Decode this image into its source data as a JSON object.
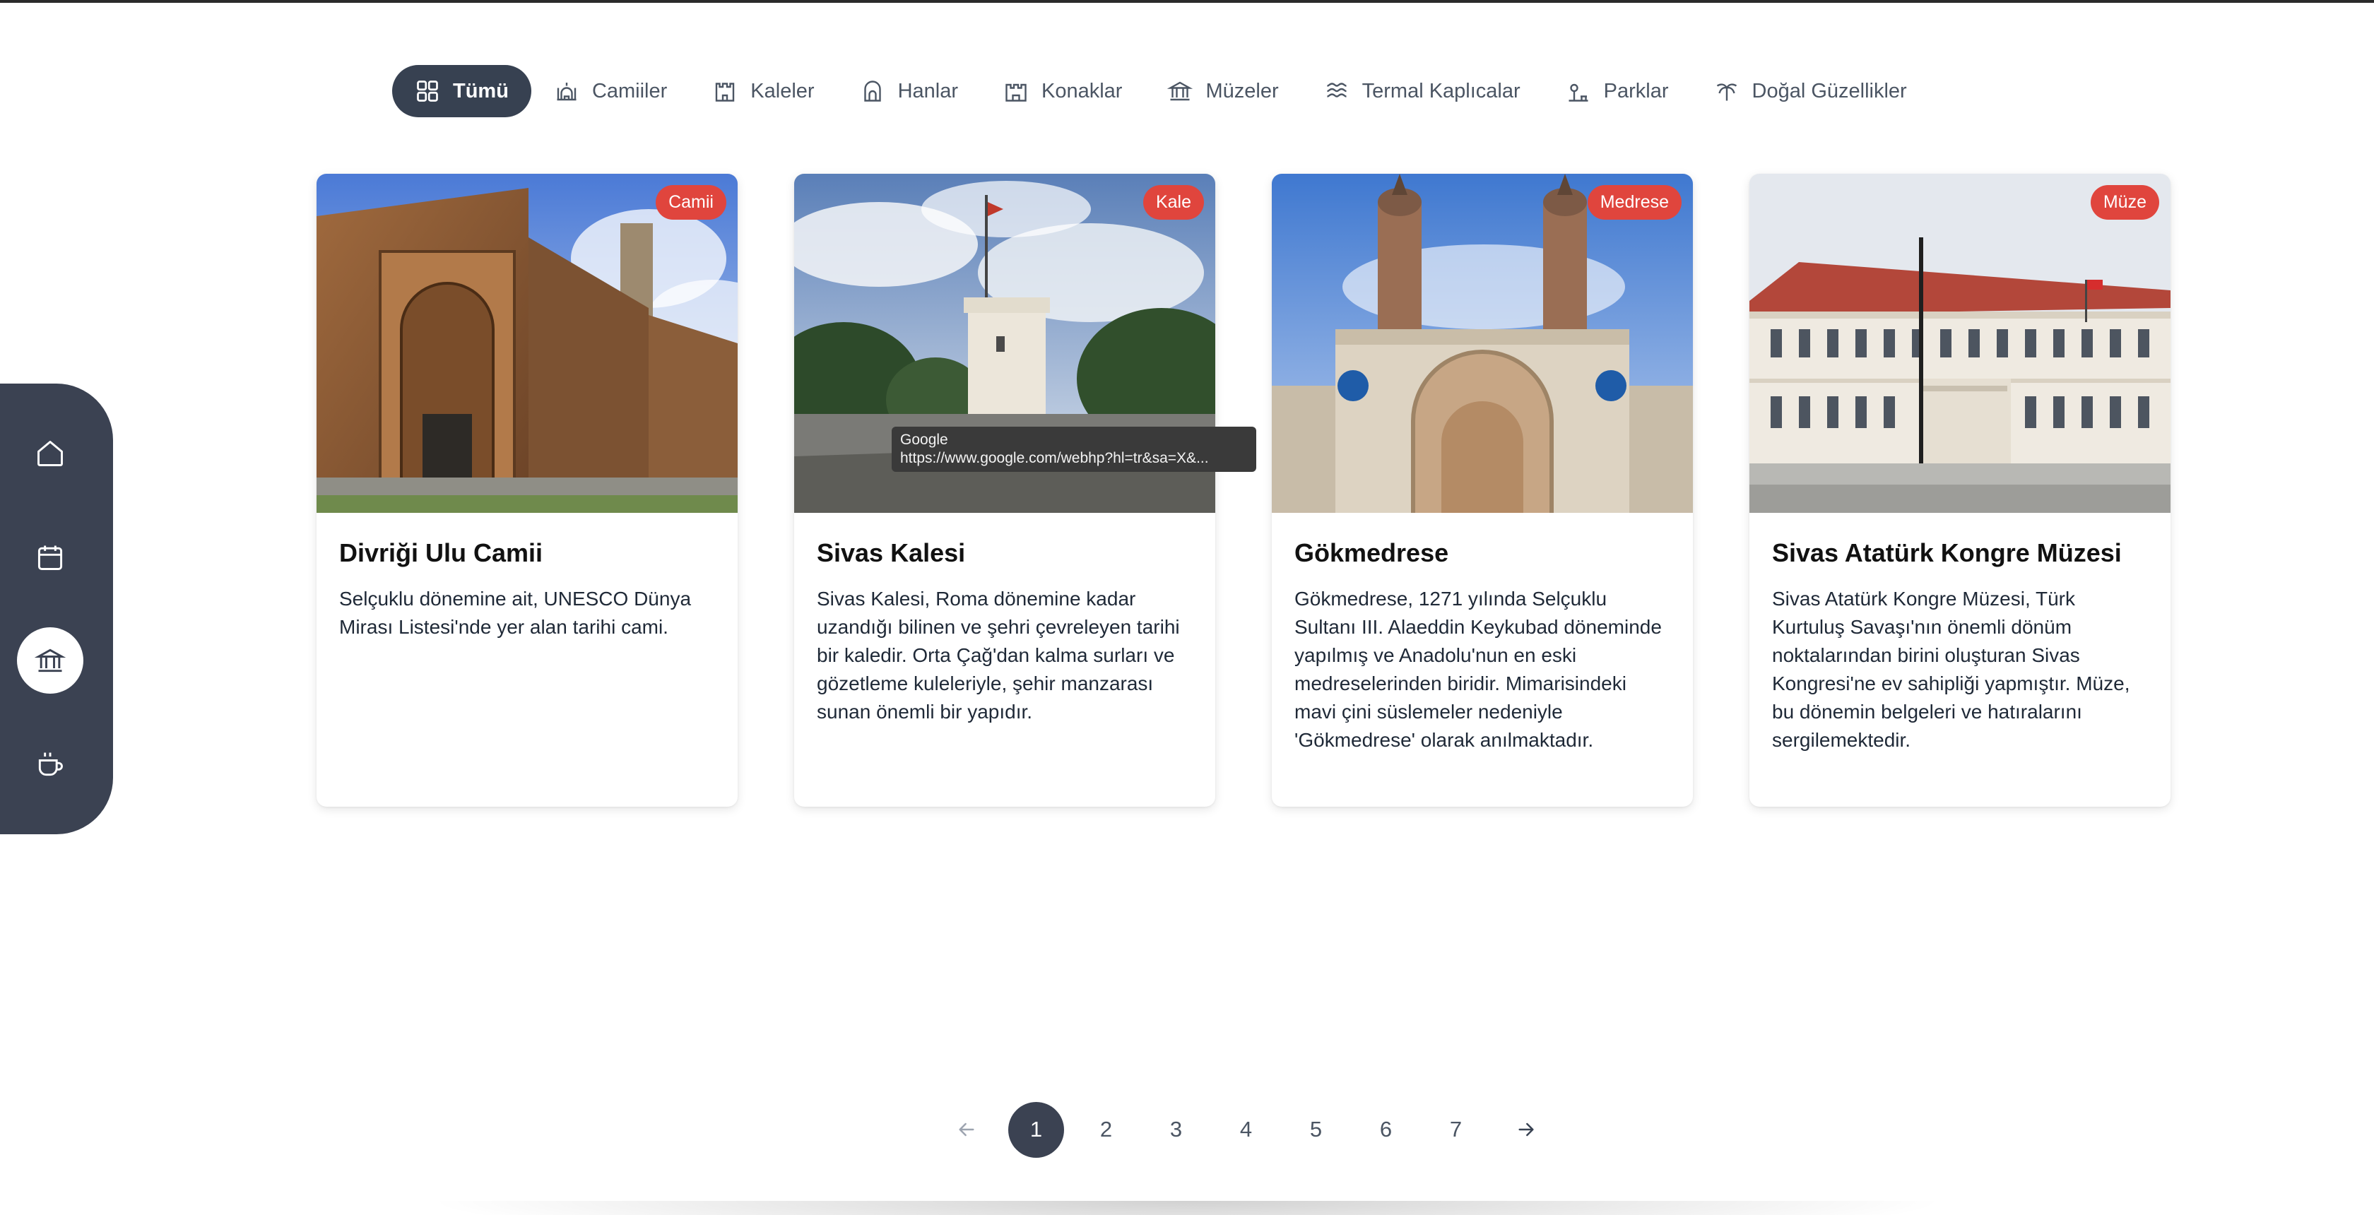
{
  "sidenav": {
    "items": [
      {
        "icon": "home-icon",
        "active": false
      },
      {
        "icon": "calendar-icon",
        "active": false
      },
      {
        "icon": "museum-icon",
        "active": true
      },
      {
        "icon": "coffee-icon",
        "active": false
      }
    ]
  },
  "tabs": [
    {
      "label": "Tümü",
      "icon": "grid-icon",
      "active": true
    },
    {
      "label": "Camiiler",
      "icon": "mosque-icon"
    },
    {
      "label": "Kaleler",
      "icon": "castle-icon"
    },
    {
      "label": "Hanlar",
      "icon": "inn-icon"
    },
    {
      "label": "Konaklar",
      "icon": "mansion-icon"
    },
    {
      "label": "Müzeler",
      "icon": "museum-icon"
    },
    {
      "label": "Termal Kaplıcalar",
      "icon": "waves-icon"
    },
    {
      "label": "Parklar",
      "icon": "park-icon"
    },
    {
      "label": "Doğal Güzellikler",
      "icon": "palm-icon"
    }
  ],
  "cards": [
    {
      "badge": "Camii",
      "title": "Divriği Ulu Camii",
      "description": "Selçuklu dönemine ait, UNESCO Dünya Mirası Listesi'nde yer alan tarihi cami."
    },
    {
      "badge": "Kale",
      "title": "Sivas Kalesi",
      "description": "Sivas Kalesi, Roma dönemine kadar uzandığı bilinen ve şehri çevreleyen tarihi bir kaledir. Orta Çağ'dan kalma surları ve gözetleme kuleleriyle, şehir manzarası sunan önemli bir yapıdır."
    },
    {
      "badge": "Medrese",
      "title": "Gökmedrese",
      "description": "Gökmedrese, 1271 yılında Selçuklu Sultanı III. Alaeddin Keykubad döneminde yapılmış ve Anadolu'nun en eski medreselerinden biridir. Mimarisindeki mavi çini süslemeler nedeniyle 'Gökmedrese' olarak anılmaktadır."
    },
    {
      "badge": "Müze",
      "title": "Sivas Atatürk Kongre Müzesi",
      "description": "Sivas Atatürk Kongre Müzesi, Türk Kurtuluş Savaşı'nın önemli dönüm noktalarından birini oluşturan Sivas Kongresi'ne ev sahipliği yapmıştır. Müze, bu dönemin belgeleri ve hatıralarını sergilemektedir."
    }
  ],
  "tooltip": {
    "line1": "Google",
    "line2": "https://www.google.com/webhp?hl=tr&sa=X&..."
  },
  "pagination": {
    "prev_icon": "arrow-left-icon",
    "next_icon": "arrow-right-icon",
    "pages": [
      "1",
      "2",
      "3",
      "4",
      "5",
      "6",
      "7"
    ],
    "current": "1"
  },
  "colors": {
    "nav_bg": "#3b4252",
    "active_tab": "#374151",
    "badge": "#e0453d"
  }
}
